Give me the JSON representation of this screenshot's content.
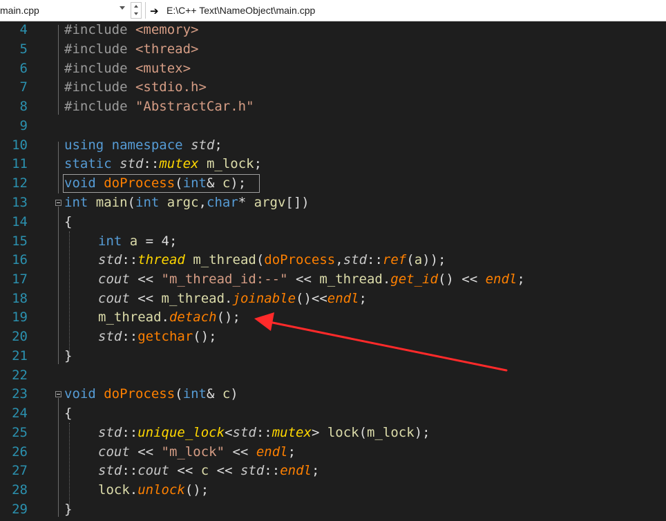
{
  "navbar": {
    "file_dropdown": "main.cpp",
    "path_arrow": "➔",
    "path": "E:\\C++ Text\\NameObject\\main.cpp"
  },
  "line_numbers": [
    "4",
    "5",
    "6",
    "7",
    "8",
    "9",
    "10",
    "11",
    "12",
    "13",
    "14",
    "15",
    "16",
    "17",
    "18",
    "19",
    "20",
    "21",
    "22",
    "23",
    "24",
    "25",
    "26",
    "27",
    "28",
    "29"
  ],
  "code": {
    "l4": [
      "#include ",
      "<memory>"
    ],
    "l5": [
      "#include ",
      "<thread>"
    ],
    "l6": [
      "#include ",
      "<mutex>"
    ],
    "l7": [
      "#include ",
      "<stdio.h>"
    ],
    "l8": [
      "#include ",
      "\"AbstractCar.h\""
    ],
    "l10": [
      "using",
      " ",
      "namespace",
      " ",
      "std",
      ";"
    ],
    "l11": [
      "static",
      " ",
      "std",
      "::",
      "mutex",
      " ",
      "m_lock",
      ";"
    ],
    "l12": [
      "void",
      " ",
      "doProcess",
      "(",
      "int",
      "& ",
      "c",
      ");"
    ],
    "l13": [
      "int",
      " ",
      "main",
      "(",
      "int",
      " ",
      "argc",
      ",",
      "char",
      "* ",
      "argv",
      "[])"
    ],
    "l14": [
      "{"
    ],
    "l15": [
      "int",
      " ",
      "a",
      " = 4;"
    ],
    "l16": [
      "std",
      "::",
      "thread",
      " ",
      "m_thread",
      "(",
      "doProcess",
      ",",
      "std",
      "::",
      "ref",
      "(",
      "a",
      "));"
    ],
    "l17": [
      "cout",
      " << ",
      "\"m_thread_id:--\"",
      " << ",
      "m_thread",
      ".",
      "get_id",
      "() << ",
      "endl",
      ";"
    ],
    "l18": [
      "cout",
      " << ",
      "m_thread",
      ".",
      "joinable",
      "()<<",
      "endl",
      ";"
    ],
    "l19": [
      "m_thread",
      ".",
      "detach",
      "();"
    ],
    "l20": [
      "std",
      "::",
      "getchar",
      "();"
    ],
    "l21": [
      "}"
    ],
    "l23": [
      "void",
      " ",
      "doProcess",
      "(",
      "int",
      "& ",
      "c",
      ")"
    ],
    "l24": [
      "{"
    ],
    "l25": [
      "std",
      "::",
      "unique_lock",
      "<",
      "std",
      "::",
      "mutex",
      "> ",
      "lock",
      "(",
      "m_lock",
      ");"
    ],
    "l26": [
      "cout",
      " << ",
      "\"m_lock\"",
      " << ",
      "endl",
      ";"
    ],
    "l27": [
      "std",
      "::",
      "cout",
      " << ",
      "c",
      " << ",
      "std",
      "::",
      "endl",
      ";"
    ],
    "l28": [
      "lock",
      ".",
      "unlock",
      "();"
    ],
    "l29": [
      "}"
    ]
  },
  "colors": {
    "annotation_arrow": "#ff2a2a",
    "background": "#1e1e1e"
  }
}
